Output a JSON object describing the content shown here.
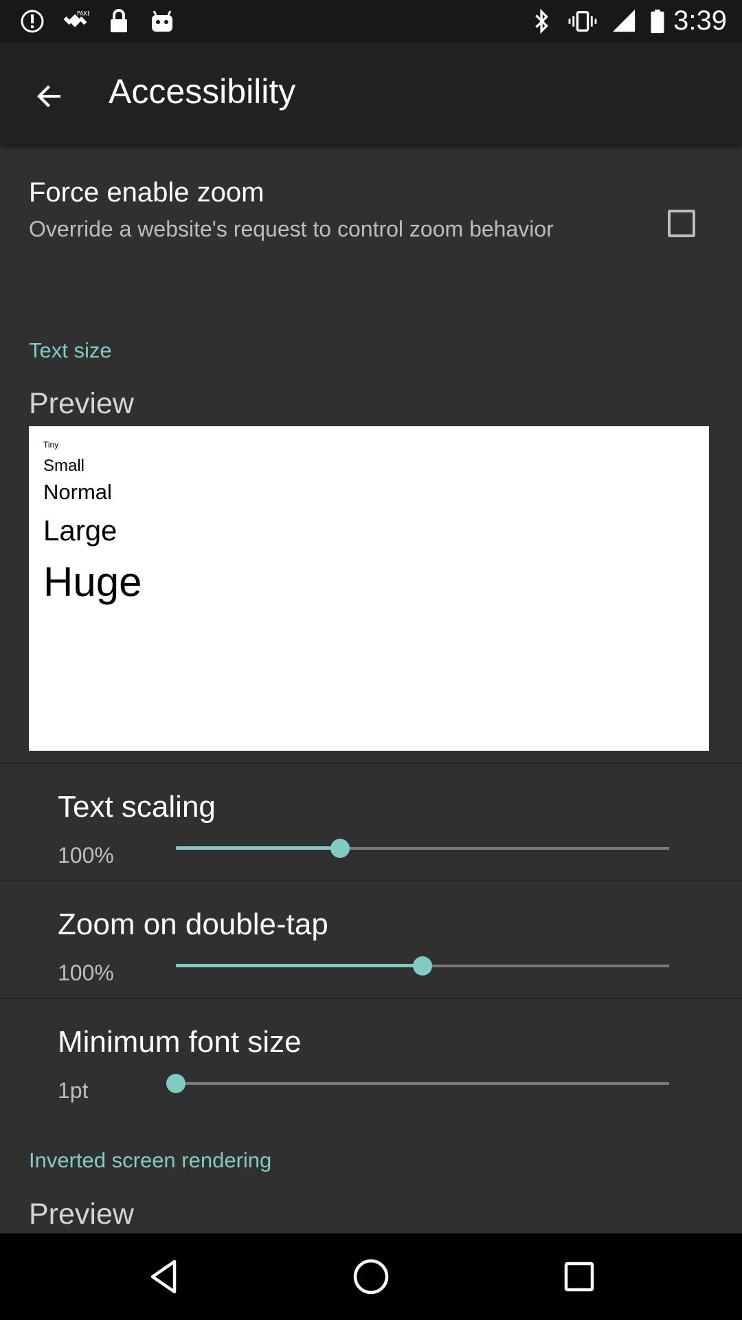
{
  "status_bar": {
    "time": "3:39",
    "icons": [
      "alert-circle-icon",
      "fake-gps-icon",
      "lock-icon",
      "android-icon",
      "bluetooth-icon",
      "vibrate-icon",
      "signal-icon",
      "battery-icon"
    ]
  },
  "app_bar": {
    "title": "Accessibility",
    "back_icon": "arrow-back-icon"
  },
  "force_zoom": {
    "title": "Force enable zoom",
    "summary": "Override a website's request to control zoom behavior",
    "checked": false
  },
  "text_size": {
    "header": "Text size",
    "preview_label": "Preview",
    "preview_samples": [
      "Tiny",
      "Small",
      "Normal",
      "Large",
      "Huge"
    ]
  },
  "text_scaling": {
    "title": "Text scaling",
    "value": "100%",
    "slider_fraction": 0.333
  },
  "zoom_double_tap": {
    "title": "Zoom on double-tap",
    "value": "100%",
    "slider_fraction": 0.5
  },
  "min_font_size": {
    "title": "Minimum font size",
    "value": "1pt",
    "slider_fraction": 0.0
  },
  "inverted": {
    "header": "Inverted screen rendering",
    "preview_label": "Preview"
  },
  "nav_bar": {
    "icons": [
      "back-triangle-icon",
      "home-circle-icon",
      "recents-square-icon"
    ]
  },
  "colors": {
    "accent": "#80cbc4",
    "background": "#303030",
    "app_bar": "#212121",
    "status_bar": "#181818"
  }
}
